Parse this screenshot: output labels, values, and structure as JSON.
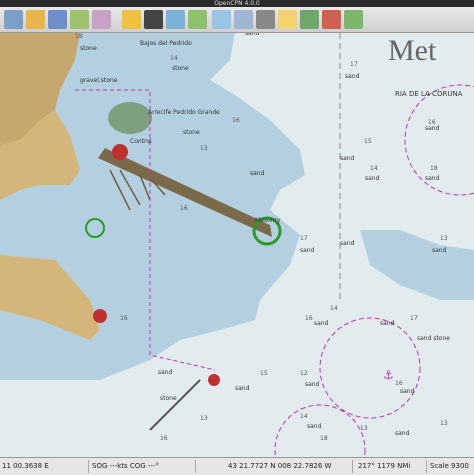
{
  "window": {
    "title": "OpenCPN 4.0.0"
  },
  "toolbar": {
    "icons": [
      "ship-icon",
      "open-chart-icon",
      "layers-icon",
      "grid-icon",
      "route-icon",
      "tide-icon",
      "measure-icon",
      "search-icon",
      "ais-icon",
      "print-icon",
      "weather-icon",
      "settings-icon",
      "sun-icon",
      "track-icon",
      "download-icon",
      "map-icon"
    ]
  },
  "chart": {
    "title_partial": "Met",
    "region": "RIA DE LA CORUNA",
    "labels": {
      "stone_tl": "stone",
      "bajos": "Bajos del Pedrido",
      "stone2": "stone",
      "gravel": "gravel.stone",
      "arrecife": "Arrecife Pedrido Grande",
      "control": "Control",
      "stone3": "stone",
      "sand_a": "sand",
      "sand_b": "sand",
      "sand_c": "sand",
      "sand_d": "sand",
      "sand_e": "sand",
      "sand_f": "sand",
      "sand_g": "sand",
      "sand_h": "sand",
      "sand_i": "sand",
      "sand_j": "sand",
      "sand_k": "sand",
      "sand_l": "sand",
      "sand_m": "sand",
      "sand_n": "sand",
      "sand_o": "sand",
      "sand_p": "sand",
      "sand_q": "sand",
      "sand_r": "sand",
      "stone4": "stone",
      "masonry": "Masonry",
      "sand_stone": "sand stone"
    },
    "depths": [
      "18",
      "14",
      "13",
      "16",
      "16",
      "17",
      "15",
      "16",
      "14",
      "18",
      "16",
      "13",
      "17",
      "14",
      "16",
      "17",
      "15",
      "12",
      "16",
      "14",
      "13",
      "16",
      "13",
      "18",
      "13"
    ]
  },
  "status": {
    "left": "11 00.3638 E",
    "sog": "SOG ---kts COG ---°",
    "pos": "43 21.7727 N   008 22.7826 W",
    "brg": "217°  1179 NMi",
    "scale": "Scale 9300"
  }
}
